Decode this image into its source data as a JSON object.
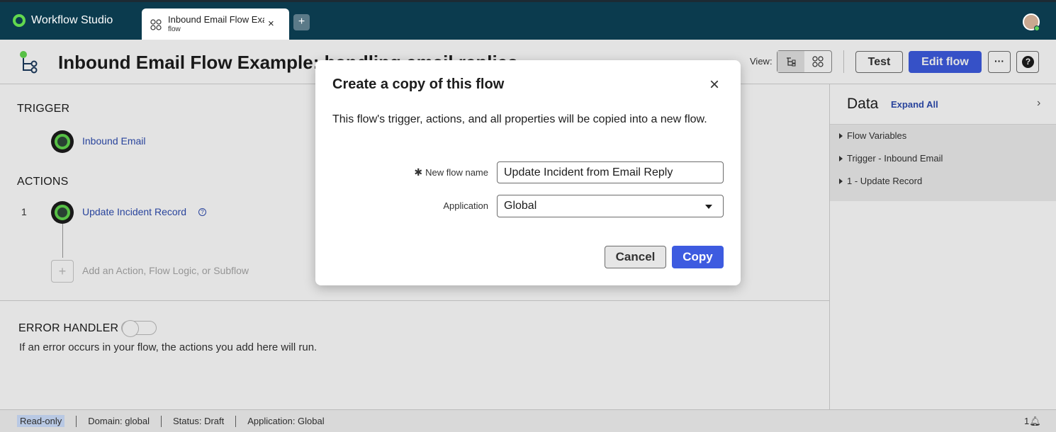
{
  "app": {
    "title": "Workflow Studio",
    "tab": {
      "title": "Inbound Email Flow Example: handling email replies",
      "subtitle": "flow",
      "close": "×"
    },
    "new_tab": "+"
  },
  "header": {
    "flow_title": "Inbound Email Flow Example: handling email replies",
    "view_label": "View:",
    "test_label": "Test",
    "edit_label": "Edit flow",
    "more_label": "···",
    "help_label": "?"
  },
  "left": {
    "trigger_heading": "TRIGGER",
    "trigger_name": "Inbound Email",
    "actions_heading": "ACTIONS",
    "action_number": "1",
    "action_name": "Update Incident Record",
    "add_text": "Add an Action, Flow Logic, or Subflow",
    "error_heading": "ERROR HANDLER",
    "error_desc": "If an error occurs in your flow, the actions you add here will run."
  },
  "data_panel": {
    "title": "Data",
    "expand_all": "Expand All",
    "items": [
      "Flow Variables",
      "Trigger - Inbound Email",
      "1 - Update Record"
    ]
  },
  "status_bar": {
    "read_only": "Read-only",
    "domain": "Domain: global",
    "status": "Status: Draft",
    "application": "Application: Global",
    "notifications": "1"
  },
  "modal": {
    "title": "Create a copy of this flow",
    "description": "This flow's trigger, actions, and all properties will be copied into a new flow.",
    "name_label": "New flow name",
    "name_value": "Update Incident from Email Reply",
    "application_label": "Application",
    "application_value": "Global",
    "cancel_label": "Cancel",
    "copy_label": "Copy"
  },
  "colors": {
    "appbar": "#0b3b4e",
    "primary": "#3d5be0",
    "link": "#2f4db0",
    "brand_green": "#62d84e"
  }
}
